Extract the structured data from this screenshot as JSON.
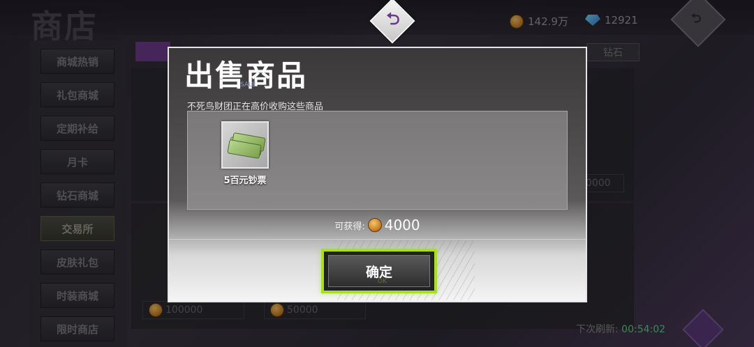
{
  "header": {
    "title": "商店",
    "gold": "142.9万",
    "diamonds": "12921"
  },
  "sidebar": {
    "items": [
      {
        "label": "商城热销"
      },
      {
        "label": "礼包商城"
      },
      {
        "label": "定期补给"
      },
      {
        "label": "月卡"
      },
      {
        "label": "钻石商城"
      },
      {
        "label": "交易所",
        "active": true
      },
      {
        "label": "皮肤礼包"
      },
      {
        "label": "时装商城"
      },
      {
        "label": "限时商店"
      }
    ]
  },
  "background": {
    "tab_label": "钻石",
    "price_left": "100000",
    "price_mid": "50000",
    "price_right": "0000",
    "refresh_label": "下次刷新:",
    "refresh_time": "00:54:02"
  },
  "dialog": {
    "title": "出售商品",
    "sale_tag": "SALE",
    "subtitle": "不死鸟财团正在高价收购这些商品",
    "item_name": "5百元钞票",
    "earn_label": "可获得:",
    "earn_value": "4000",
    "confirm_label": "确定",
    "confirm_ghost": "OK"
  },
  "colors": {
    "accent_green": "#a8e020",
    "purple": "#6a3a8a",
    "refresh_time": "#5fd08a"
  },
  "icons": {
    "gold": "coin-icon",
    "diamond": "diamond-icon",
    "back": "return-arrow-icon",
    "refresh": "refresh-icon",
    "item": "banknote-stack-icon"
  }
}
